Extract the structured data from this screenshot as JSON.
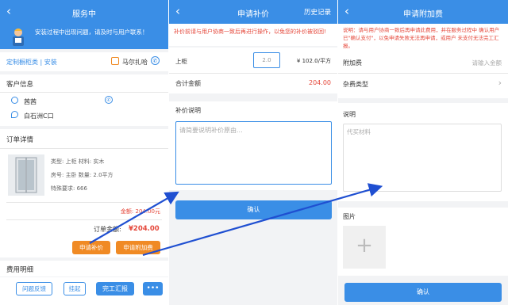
{
  "panel1": {
    "title": "服务中",
    "banner_text": "安装过程中出现问题，请及时与用户联系！",
    "category": "定制橱柜类 | 安装",
    "location": "马尔扎哈",
    "customer_section": "客户信息",
    "customer_name": "茜茜",
    "customer_address": "白石洲C口",
    "order_section": "订单详情",
    "order_type": "类型: 上柜   材料: 实木",
    "order_room": "房号: 主卧   数量: 2.0平方",
    "order_special": "特殊要求: 666",
    "amount_label": "金额: 204.00元",
    "total_label": "订单金额:",
    "total_value": "¥204.00",
    "btn_reprice": "申请补价",
    "btn_extra_fee": "申请附加费",
    "fee_section": "费用明细",
    "btn_feedback": "问题反馈",
    "btn_suspend": "挂起",
    "btn_complete": "完工汇报",
    "btn_more": "•••"
  },
  "panel2": {
    "title": "申请补价",
    "history": "历史记录",
    "notice": "补价前请与用户协商一致后再进行操作，以免您的补价被驳回!",
    "item_label": "上柜",
    "item_qty": "2.0",
    "item_price": "¥ 102.0/平方",
    "total_label": "合计金额",
    "total_value": "204.00",
    "reason_title": "补价说明",
    "reason_placeholder": "请简要说明补价原由...",
    "confirm": "确认"
  },
  "panel3": {
    "title": "申请附加费",
    "notice": "说明：请与用户协商一致后再申请此费用，并在服务过程中 确认用户已\"确认支付\"，以免申请失败无法再申请，或用户 未支付无法完工汇报。",
    "fee_label": "附加费",
    "fee_placeholder": "请输入金额",
    "type_label": "杂费类型",
    "desc_title": "说明",
    "desc_placeholder": "代买材料",
    "image_title": "图片",
    "confirm": "确认"
  },
  "colors": {
    "primary": "#3a8ee6",
    "accent": "#f08a24",
    "danger": "#e5483b"
  }
}
